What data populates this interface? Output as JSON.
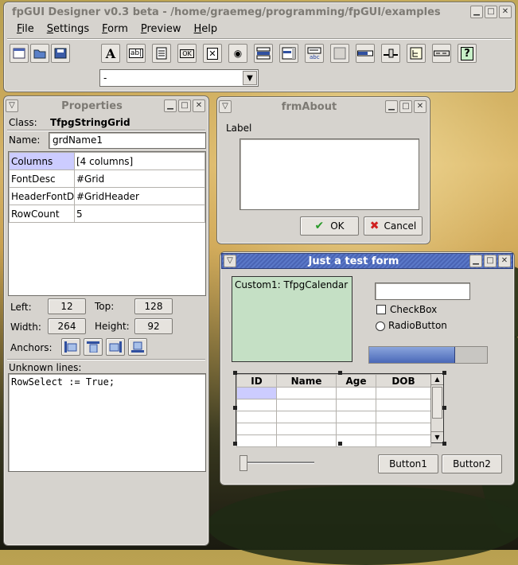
{
  "main_window": {
    "title": "fpGUI Designer v0.3 beta - /home/graemeg/programming/fpGUI/examples",
    "menu": [
      "File",
      "Settings",
      "Form",
      "Preview",
      "Help"
    ],
    "menu_underline": [
      "F",
      "S",
      "F",
      "P",
      "H"
    ],
    "toolbar_icons": [
      "new-form-icon",
      "open-folder-icon",
      "save-disk-icon",
      "label-tool-icon",
      "edit-tool-icon",
      "memo-tool-icon",
      "button-tool-icon",
      "checkbox-tool-icon",
      "radiobutton-tool-icon",
      "combobox-tool-icon",
      "listbox-tool-icon",
      "stringgrid-tool-icon",
      "panel-tool-icon",
      "progressbar-tool-icon",
      "trackbar-tool-icon",
      "treeview-tool-icon",
      "menubar-tool-icon",
      "help-tool-icon"
    ],
    "toolbar_glyphs": {
      "label": "A",
      "edit": "ab|",
      "button": "OK",
      "checkbox": "✕",
      "radio": "◉",
      "help": "?"
    },
    "component_combo_value": "-"
  },
  "properties": {
    "title": "Properties",
    "class_label": "Class:",
    "class_value": "TfpgStringGrid",
    "name_label": "Name:",
    "name_value": "grdName1",
    "rows": [
      {
        "name": "Columns",
        "value": "[4 columns]"
      },
      {
        "name": "FontDesc",
        "value": "#Grid"
      },
      {
        "name": "HeaderFontDesc",
        "value": "#GridHeader"
      },
      {
        "name": "RowCount",
        "value": "5"
      }
    ],
    "left_label": "Left:",
    "left_value": "12",
    "top_label": "Top:",
    "top_value": "128",
    "width_label": "Width:",
    "width_value": "264",
    "height_label": "Height:",
    "height_value": "92",
    "anchors_label": "Anchors:",
    "unknown_label": "Unknown lines:",
    "unknown_text": "RowSelect := True;"
  },
  "frm_about": {
    "title": "frmAbout",
    "label": "Label",
    "ok": "OK",
    "cancel": "Cancel"
  },
  "test_form": {
    "title": "Just a test form",
    "calendar_text": "Custom1: TfpgCalendar",
    "checkbox_label": "CheckBox",
    "radio_label": "RadioButton",
    "progress_fraction": 0.73,
    "grid_columns": [
      "ID",
      "Name",
      "Age",
      "DOB"
    ],
    "button1": "Button1",
    "button2": "Button2"
  },
  "colors": {
    "active_title": "#4a64b4",
    "calendar_bg": "#c5e0c5",
    "progress_fill": "#5878c0",
    "selected_cell": "#ccccff"
  }
}
